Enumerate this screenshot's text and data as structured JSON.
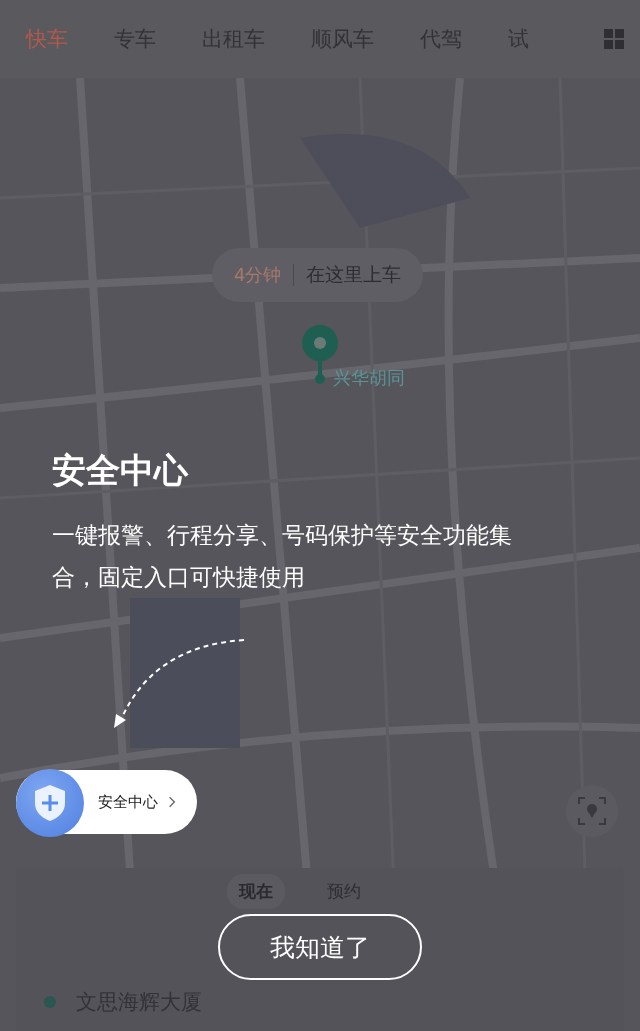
{
  "tabs": [
    {
      "label": "快车",
      "selected": true
    },
    {
      "label": "专车",
      "selected": false
    },
    {
      "label": "出租车",
      "selected": false
    },
    {
      "label": "顺风车",
      "selected": false
    },
    {
      "label": "代驾",
      "selected": false
    },
    {
      "label": "试",
      "selected": false
    }
  ],
  "pickup": {
    "eta": "4分钟",
    "label": "在这里上车"
  },
  "pin": {
    "label": "兴华胡同"
  },
  "guide": {
    "title": "安全中心",
    "description": "一键报警、行程分享、号码保护等安全功能集合，固定入口可快捷使用"
  },
  "safety_entry": {
    "label": "安全中心"
  },
  "booking": {
    "modes": [
      {
        "label": "现在",
        "selected": true
      },
      {
        "label": "预约",
        "selected": false
      }
    ],
    "origin": "文思海辉大厦"
  },
  "dismiss_button": "我知道了"
}
